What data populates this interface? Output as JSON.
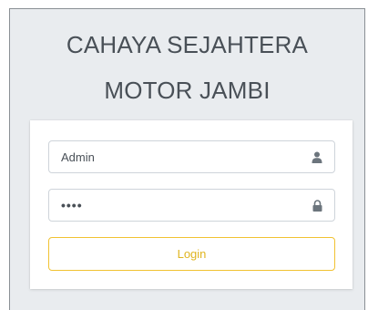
{
  "brand": {
    "line1": "CAHAYA SEJAHTERA",
    "line2": "MOTOR JAMBI"
  },
  "form": {
    "username_value": "Admin",
    "password_value": "••••",
    "username_icon": "user-icon",
    "password_icon": "lock-icon",
    "login_label": "Login"
  },
  "colors": {
    "background": "#e9ecef",
    "card": "#ffffff",
    "text": "#495057",
    "button_border": "#f1c232",
    "button_text": "#e0b520",
    "icon": "#6c757d"
  }
}
